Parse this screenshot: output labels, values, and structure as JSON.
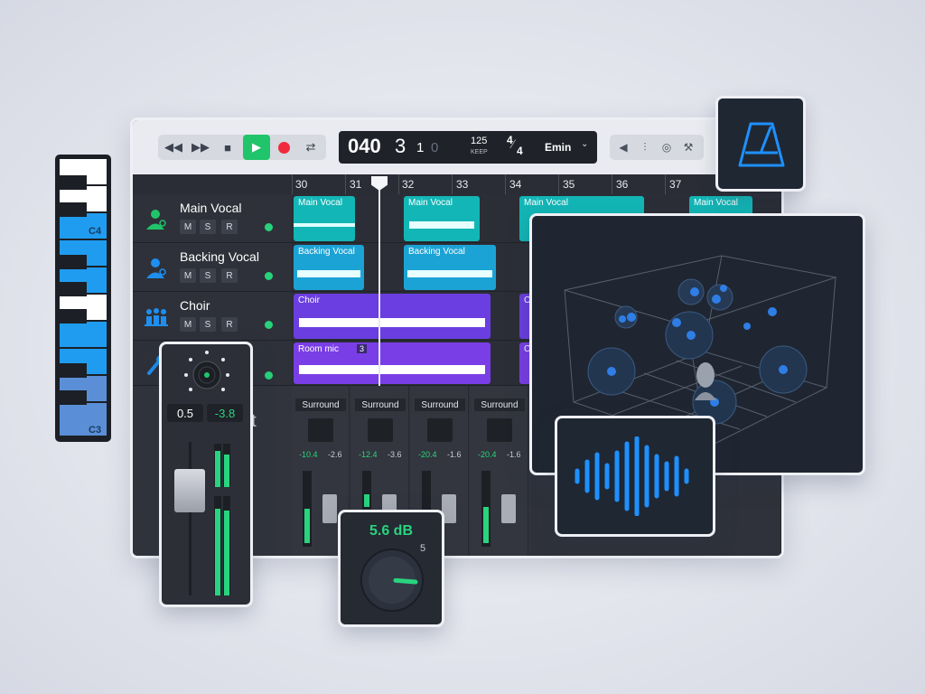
{
  "transport": {
    "position_bars": "040",
    "position_beat": "3",
    "position_div": "1",
    "position_tick": "0",
    "tempo": "125",
    "tempo_mode": "KEEP",
    "time_sig_top": "4",
    "time_sig_bottom": "4",
    "key": "Emin"
  },
  "ruler": [
    "30",
    "31",
    "32",
    "33",
    "34",
    "35",
    "36",
    "37"
  ],
  "tracks": [
    {
      "name": "Main Vocal",
      "m": "M",
      "s": "S",
      "r": "R"
    },
    {
      "name": "Backing Vocal",
      "m": "M",
      "s": "S",
      "r": "R"
    },
    {
      "name": "Choir",
      "m": "M",
      "s": "S",
      "r": "R"
    },
    {
      "name": "",
      "m": "",
      "s": "",
      "r": ""
    }
  ],
  "clips": {
    "main_vocal": [
      "Main Vocal",
      "Main Vocal",
      "Main Vocal",
      "Main Vocal"
    ],
    "backing_vocal": [
      "Backing Vocal",
      "Backing Vocal"
    ],
    "choir": [
      "Choir",
      "C"
    ],
    "room": [
      "Room mic",
      "3",
      "C"
    ]
  },
  "mixer": {
    "strips": [
      {
        "name": "Surround",
        "v1": "-10.4",
        "v2": "-2.6"
      },
      {
        "name": "Surround",
        "v1": "-12.4",
        "v2": "-3.6"
      },
      {
        "name": "Surround",
        "v1": "-20.4",
        "v2": "-1.6"
      },
      {
        "name": "Surround",
        "v1": "-20.4",
        "v2": "-1.6"
      }
    ],
    "partial_label": "ut"
  },
  "piano": {
    "label_high": "C4",
    "label_low": "C3"
  },
  "fader_panel": {
    "pan_value": "0.5",
    "gain_value": "-3.8"
  },
  "knob_panel": {
    "value": "5.6 dB",
    "max_label": "5",
    "level": 0.85
  },
  "colors": {
    "teal": "#14b8b8",
    "purple": "#6a3ee0",
    "green": "#20c46a",
    "blue": "#1e8ff0",
    "record": "#f02a3c"
  },
  "icons": {
    "metronome": "metronome-icon",
    "waveform": "waveform-icon",
    "space": "3d-space-icon"
  }
}
